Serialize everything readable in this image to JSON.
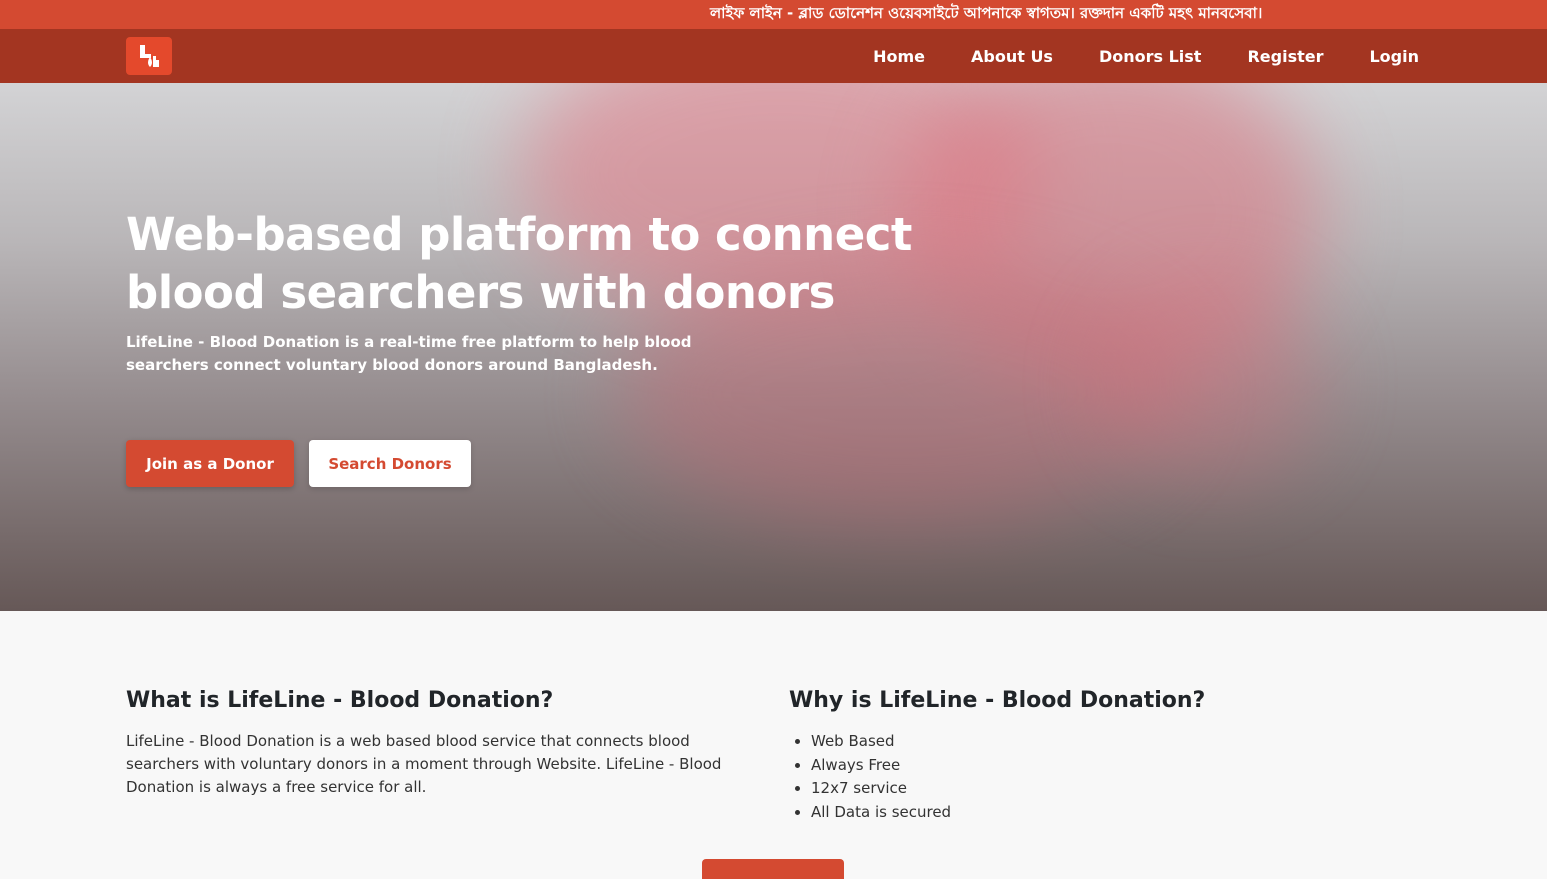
{
  "marquee": {
    "text": "লাইফ লাইন - ব্লাড ডোনেশন ওয়েবসাইটে আপনাকে স্বাগতম। রক্তদান একটি মহৎ মানবসেবা।"
  },
  "nav": {
    "logo_icon": "lifeline-logo-icon",
    "links": [
      "Home",
      "About Us",
      "Donors List",
      "Register",
      "Login"
    ]
  },
  "hero": {
    "title": "Web-based platform to connect blood searchers with donors",
    "subtitle": "LifeLine - Blood Donation is a real-time free platform to help blood searchers connect voluntary blood donors around Bangladesh.",
    "primary_button": "Join as a Donor",
    "secondary_button": "Search Donors"
  },
  "about": {
    "heading": "What is LifeLine - Blood Donation?",
    "body": "LifeLine - Blood Donation is a web based blood service that connects blood searchers with voluntary donors in a moment through Website. LifeLine - Blood Donation is always a free service for all."
  },
  "why": {
    "heading": "Why is LifeLine - Blood Donation?",
    "items": [
      "Web Based",
      "Always Free",
      "12x7 service",
      "All Data is secured"
    ]
  },
  "colors": {
    "brand": "#d44a31",
    "navbar": "#a33521",
    "marquee_bg": "#d44a31"
  }
}
